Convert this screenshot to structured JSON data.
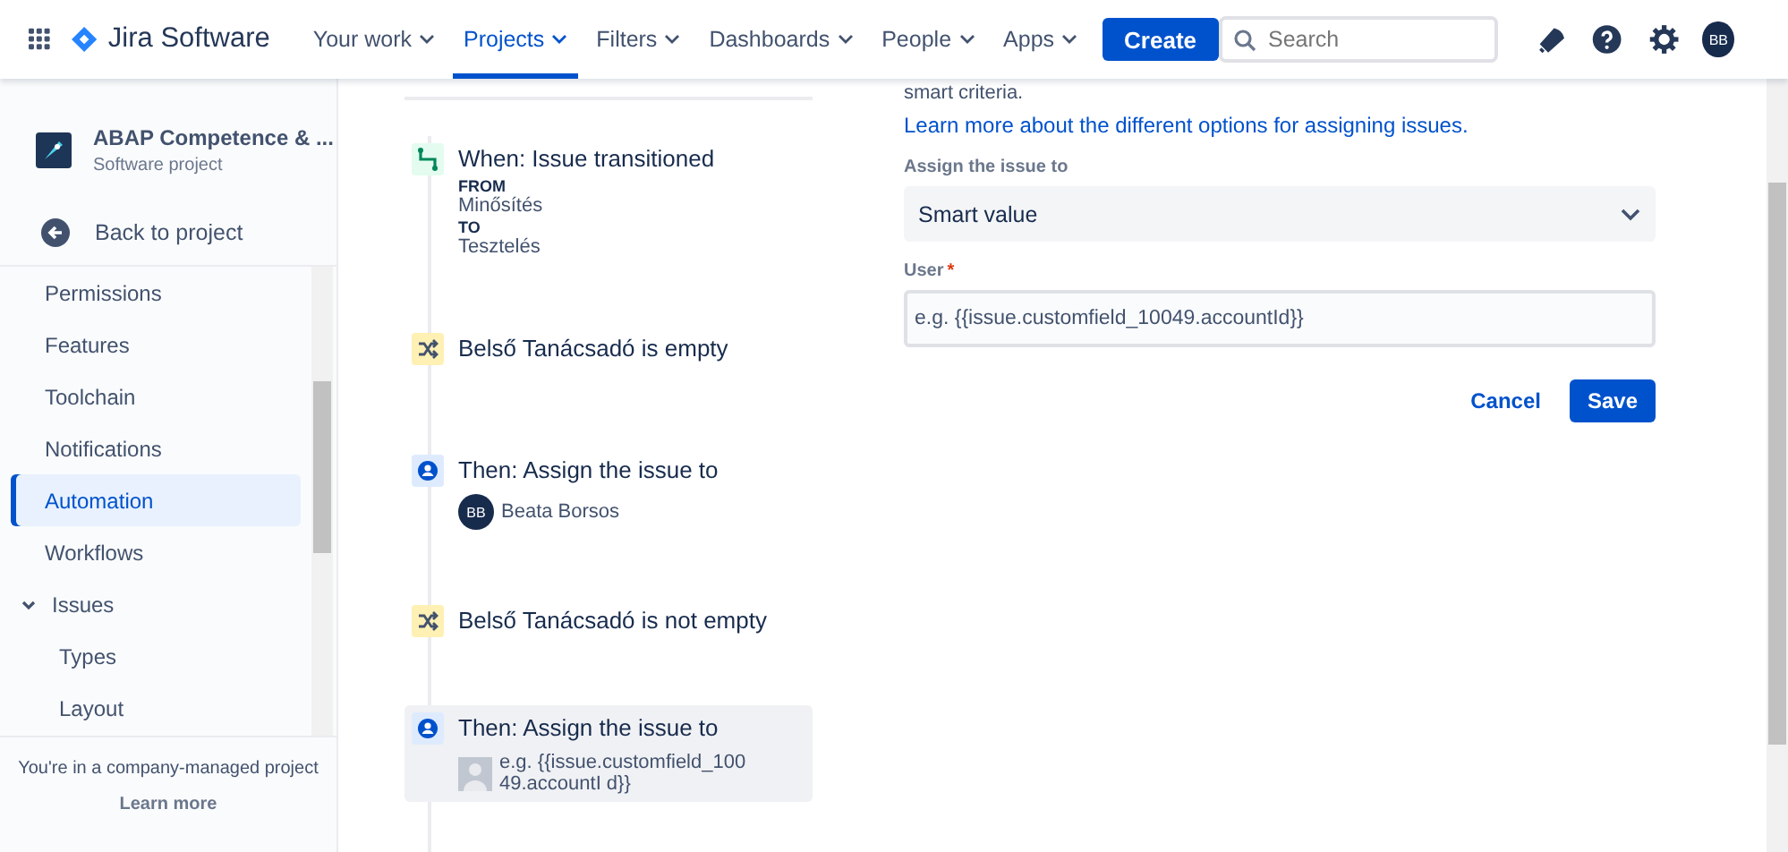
{
  "header": {
    "product": "Jira Software",
    "nav": [
      {
        "label": "Your work",
        "selected": false
      },
      {
        "label": "Projects",
        "selected": true
      },
      {
        "label": "Filters",
        "selected": false
      },
      {
        "label": "Dashboards",
        "selected": false
      },
      {
        "label": "People",
        "selected": false
      },
      {
        "label": "Apps",
        "selected": false
      }
    ],
    "create": "Create",
    "search": {
      "placeholder": "Search"
    },
    "avatar": "BB"
  },
  "sidebar": {
    "project": {
      "name": "ABAP Competence & ...",
      "type": "Software project"
    },
    "back": "Back to project",
    "items": [
      {
        "label": "Permissions",
        "selected": false
      },
      {
        "label": "Features",
        "selected": false
      },
      {
        "label": "Toolchain",
        "selected": false
      },
      {
        "label": "Notifications",
        "selected": false
      },
      {
        "label": "Automation",
        "selected": true
      },
      {
        "label": "Workflows",
        "selected": false
      },
      {
        "label": "Issues",
        "selected": false,
        "expanded": true,
        "children": [
          {
            "label": "Types",
            "selected": false
          },
          {
            "label": "Layout",
            "selected": false
          }
        ]
      }
    ],
    "footer": "You're in a company-managed project",
    "footer_link": "Learn more"
  },
  "rule": [
    {
      "kind": "trigger",
      "title": "When: Issue transitioned",
      "selected": false,
      "details": [
        {
          "label": "FROM",
          "value": "Minősítés"
        },
        {
          "label": "TO",
          "value": "Tesztelés"
        }
      ]
    },
    {
      "kind": "condition",
      "title": "Belső Tanácsadó is empty",
      "selected": false
    },
    {
      "kind": "action",
      "title": "Then: Assign the issue to",
      "selected": false,
      "assignee": {
        "initials": "BB",
        "name": "Beata Borsos",
        "kind": "initials"
      }
    },
    {
      "kind": "condition",
      "title": "Belső Tanácsadó is not empty",
      "selected": false
    },
    {
      "kind": "action",
      "title": "Then: Assign the issue to",
      "selected": true,
      "assignee": {
        "name": "e.g. {{issue.customfield_10049.accountI d}}",
        "kind": "unknown"
      }
    }
  ],
  "panel": {
    "cut_text": "smart criteria.",
    "link": "Learn more about the different options for assigning issues.",
    "assign_label": "Assign the issue to",
    "assign_value": "Smart value",
    "user_label": "User",
    "user_required_mark": "*",
    "user_placeholder": "e.g. {{issue.customfield_10049.accountId}}",
    "cancel": "Cancel",
    "save": "Save"
  }
}
